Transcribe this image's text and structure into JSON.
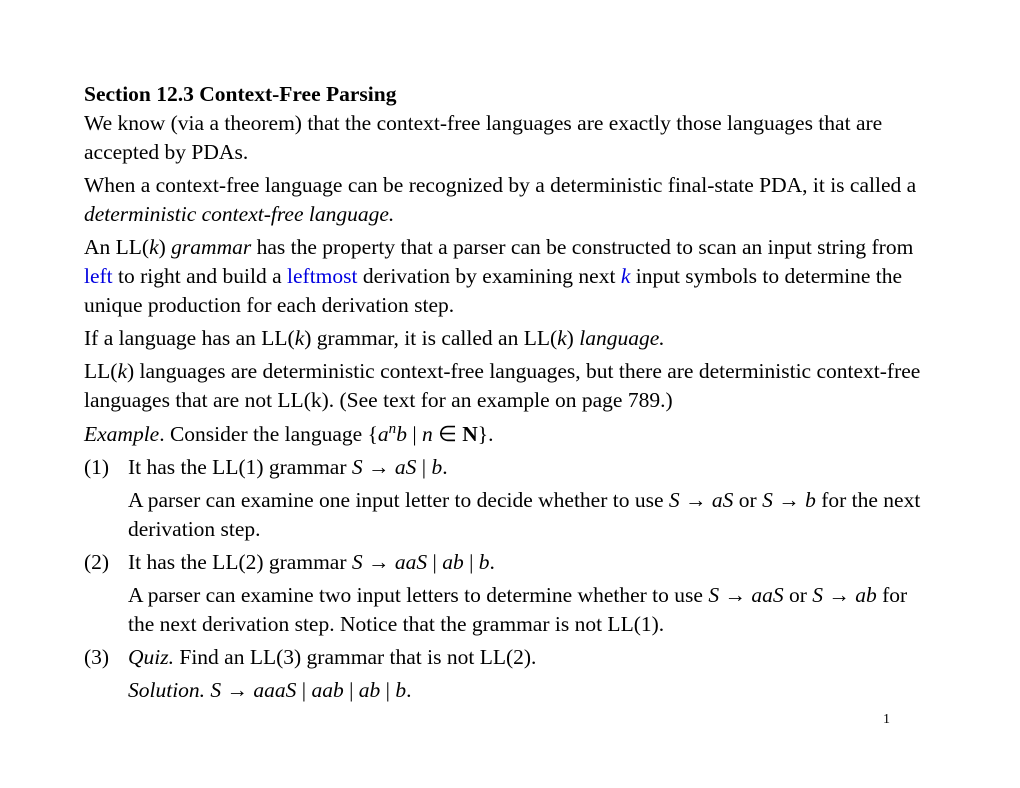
{
  "heading": "Section 12.3 Context-Free Parsing",
  "p1": "We know (via a theorem) that the context-free languages are exactly those languages that are accepted by PDAs.",
  "p2a": "When a context-free language can be recognized by a deterministic final-state PDA, it is called a ",
  "p2b": "deterministic context-free language.",
  "p3a": "An LL(",
  "p3b": "k",
  "p3c": ") ",
  "p3d": "grammar",
  "p3e": " has the property that a parser can be constructed to scan an input string from ",
  "p3f": "left",
  "p3g": " to right and build a ",
  "p3h": "leftmost",
  "p3i": " derivation by examining next ",
  "p3j": "k",
  "p3k": " input symbols to determine the unique production for each derivation step.",
  "p4a": "If a language has an LL(",
  "p4b": "k",
  "p4c": ") grammar, it is called an LL(",
  "p4d": "k",
  "p4e": ") ",
  "p4f": "language.",
  "p5a": "LL(",
  "p5b": "k",
  "p5c": ") languages are deterministic context-free languages, but there are deterministic context-free languages that are not LL(k). (See text for an example on page 789.)",
  "p6a": "Example",
  "p6b": ". Consider the language {",
  "p6c": "a",
  "p6d": "n",
  "p6e": "b",
  "p6f": " | ",
  "p6g": "n",
  "p6h": " ∈ ",
  "p6i": "N",
  "p6j": "}.",
  "l1num": "(1)",
  "l1a": "It has the LL(1) grammar ",
  "l1b": "S",
  "l1c": " → ",
  "l1d": "aS",
  "l1e": " | ",
  "l1f": "b",
  "l1g": ".",
  "l1sub_a": "A parser can examine one input letter to decide whether to use ",
  "l1sub_b": "S",
  "l1sub_c": " → ",
  "l1sub_d": "aS",
  "l1sub_e": " or ",
  "l1sub_f": "S",
  "l1sub_g": " → ",
  "l1sub_h": "b",
  "l1sub_i": " for the next derivation step.",
  "l2num": "(2)",
  "l2a": "It has the LL(2) grammar ",
  "l2b": "S",
  "l2c": " → ",
  "l2d": "aaS",
  "l2e": " | ",
  "l2f": "ab",
  "l2g": " | ",
  "l2h": "b",
  "l2i": ".",
  "l2sub_a": "A parser can examine two input letters to determine whether to use ",
  "l2sub_b": "S",
  "l2sub_c": " → ",
  "l2sub_d": "aaS",
  "l2sub_e": " or ",
  "l2sub_f": "S",
  "l2sub_g": " → ",
  "l2sub_h": "ab",
  "l2sub_i": " for the next derivation step. Notice that the grammar is not LL(1).",
  "l3num": "(3)",
  "l3a": "Quiz.",
  "l3b": " Find an LL(3) grammar that is not LL(2).",
  "l3sub_a": "Solution.",
  "l3sub_b": " S",
  "l3sub_c": " → ",
  "l3sub_d": "aaaS",
  "l3sub_e": " | ",
  "l3sub_f": "aab",
  "l3sub_g": " | ",
  "l3sub_h": "ab",
  "l3sub_i": " | ",
  "l3sub_j": "b",
  "l3sub_k": ".",
  "pagenum": "1"
}
